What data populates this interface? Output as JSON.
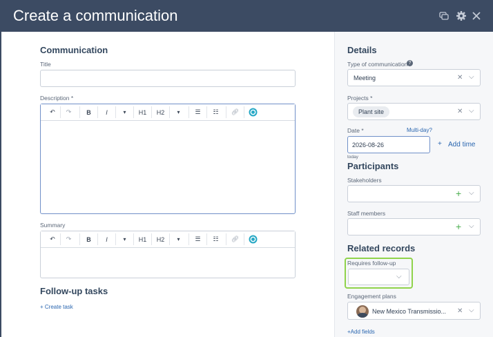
{
  "header": {
    "title": "Create a communication"
  },
  "left": {
    "communication_heading": "Communication",
    "title_label": "Title",
    "description_label": "Description *",
    "summary_label": "Summary",
    "followup_heading": "Follow-up tasks",
    "create_task": "+ Create task",
    "toolbar": {
      "bold": "B",
      "italic": "I",
      "h1": "H1",
      "h2": "H2"
    }
  },
  "right": {
    "details_heading": "Details",
    "type_label": "Type of communication",
    "type_value": "Meeting",
    "projects_label": "Projects *",
    "project_chip": "Plant site",
    "date_label": "Date *",
    "multiday": "Multi-day?",
    "date_value": "2026-08-26",
    "today": "today",
    "add_time": "Add time",
    "participants_heading": "Participants",
    "stakeholders_label": "Stakeholders",
    "staff_label": "Staff members",
    "related_heading": "Related records",
    "requires_followup_label": "Requires follow-up",
    "engagement_label": "Engagement plans",
    "engagement_value": "New Mexico Transmissio...",
    "add_fields": "+Add fields"
  },
  "colors": {
    "header": "#3c4b63",
    "accent_link": "#2a66b0",
    "highlight": "#8fd34a",
    "plus": "#4caf50"
  }
}
